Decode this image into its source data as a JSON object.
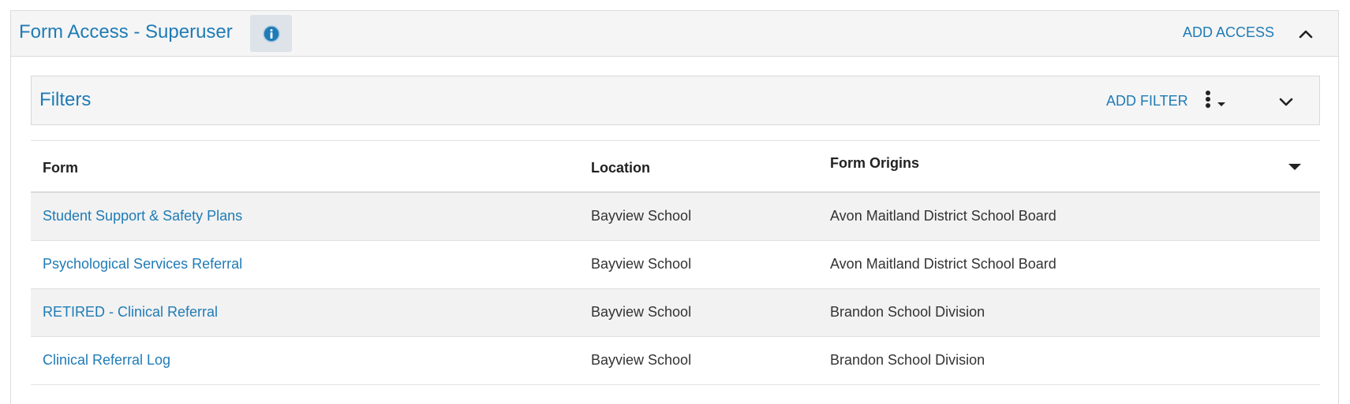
{
  "panel": {
    "title": "Form Access - Superuser",
    "add_access_label": "ADD ACCESS"
  },
  "filters": {
    "title": "Filters",
    "add_filter_label": "ADD FILTER"
  },
  "table": {
    "headers": {
      "form": "Form",
      "location": "Location",
      "origins": "Form Origins"
    },
    "rows": [
      {
        "form": "Student Support & Safety Plans",
        "location": "Bayview School",
        "origin": "Avon Maitland District School Board"
      },
      {
        "form": "Psychological Services Referral",
        "location": "Bayview School",
        "origin": "Avon Maitland District School Board"
      },
      {
        "form": "RETIRED - Clinical Referral",
        "location": "Bayview School",
        "origin": "Brandon School Division"
      },
      {
        "form": "Clinical Referral Log",
        "location": "Bayview School",
        "origin": "Brandon School Division"
      }
    ]
  },
  "icons": {
    "info": "info-icon",
    "collapse": "chevron-up-icon",
    "expand": "chevron-down-icon",
    "more": "kebab-menu-icon",
    "sort": "caret-down-icon"
  },
  "colors": {
    "link": "#1f7bb6",
    "header_bg": "#f5f5f5",
    "row_alt_bg": "#f2f2f2"
  }
}
